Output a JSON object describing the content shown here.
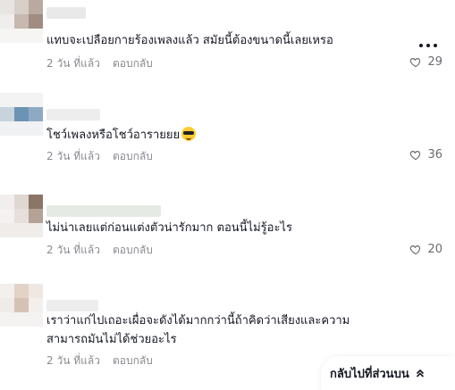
{
  "comments": [
    {
      "text": "แทบจะเปลือยกายร้องเพลงแล้ว สมัยนี้ต้องขนาดนี้เลยเหรอ",
      "time": "2 วัน ที่แล้ว",
      "reply": "ตอบกลับ",
      "likes": "29"
    },
    {
      "text": "โชว์เพลงหรือโชว์อารายยย",
      "emoji": "sunglasses-emoji",
      "time": "2 วัน ที่แล้ว",
      "reply": "ตอบกลับ",
      "likes": "36"
    },
    {
      "text": "ไม่น่าเลยแต่ก่อนแต่งตัวน่ารักมาก ตอนนี้ไม่รู้อะไร",
      "time": "2 วัน ที่แล้ว",
      "reply": "ตอบกลับ",
      "likes": "20"
    },
    {
      "text_line1": "เราว่าแก่ไปเถอะเผื่อจะดังได้มากกว่านี้ถ้าคิดว่าเสียงและความ",
      "text_line2": "สามารถมันไม่ได้ช่วยอะไร",
      "time": "2 วัน ที่แล้ว",
      "reply": "ตอบกลับ"
    }
  ],
  "back_to_top": {
    "label": "กลับไปที่ส่วนบน",
    "icon": "double-chevron-up-icon"
  },
  "colors": {
    "text": "#161823",
    "meta": "#8a8b91",
    "like": "#6b6c72"
  }
}
